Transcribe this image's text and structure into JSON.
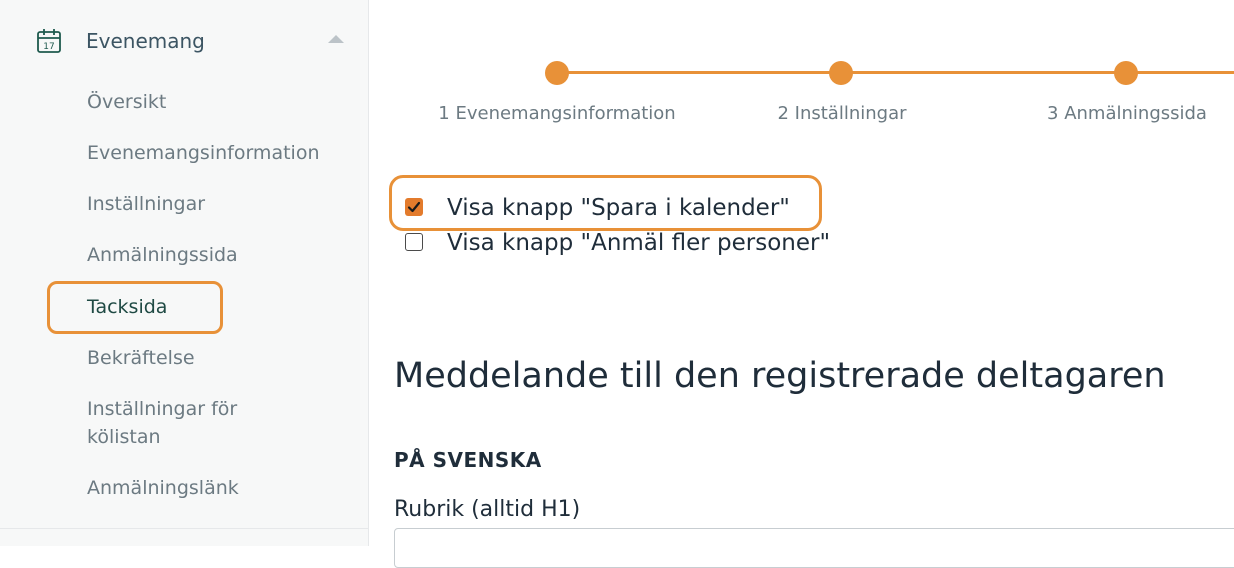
{
  "sidebar": {
    "section_title": "Evenemang",
    "items": [
      {
        "label": "Översikt"
      },
      {
        "label": "Evenemangsinformation"
      },
      {
        "label": "Inställningar"
      },
      {
        "label": "Anmälningssida"
      },
      {
        "label": "Tacksida",
        "active": true
      },
      {
        "label": "Bekräftelse"
      },
      {
        "label": "Inställningar för kölistan"
      },
      {
        "label": "Anmälningslänk"
      }
    ]
  },
  "stepper": {
    "steps": [
      {
        "label": "1 Evenemangsinformation"
      },
      {
        "label": "2 Inställningar"
      },
      {
        "label": "3 Anmälningssida"
      }
    ]
  },
  "options": [
    {
      "label": "Visa knapp \"Spara i kalender\"",
      "checked": true
    },
    {
      "label": "Visa knapp \"Anmäl fler personer\"",
      "checked": false
    }
  ],
  "message": {
    "heading": "Meddelande till den registrerade deltagaren",
    "language_label": "PÅ SVENSKA",
    "field_label": "Rubrik (alltid H1)",
    "field_value": ""
  },
  "colors": {
    "accent": "#e89138",
    "active_text": "#1f4a44"
  },
  "icons": {
    "section": "calendar-icon",
    "collapse": "caret-up-icon"
  }
}
